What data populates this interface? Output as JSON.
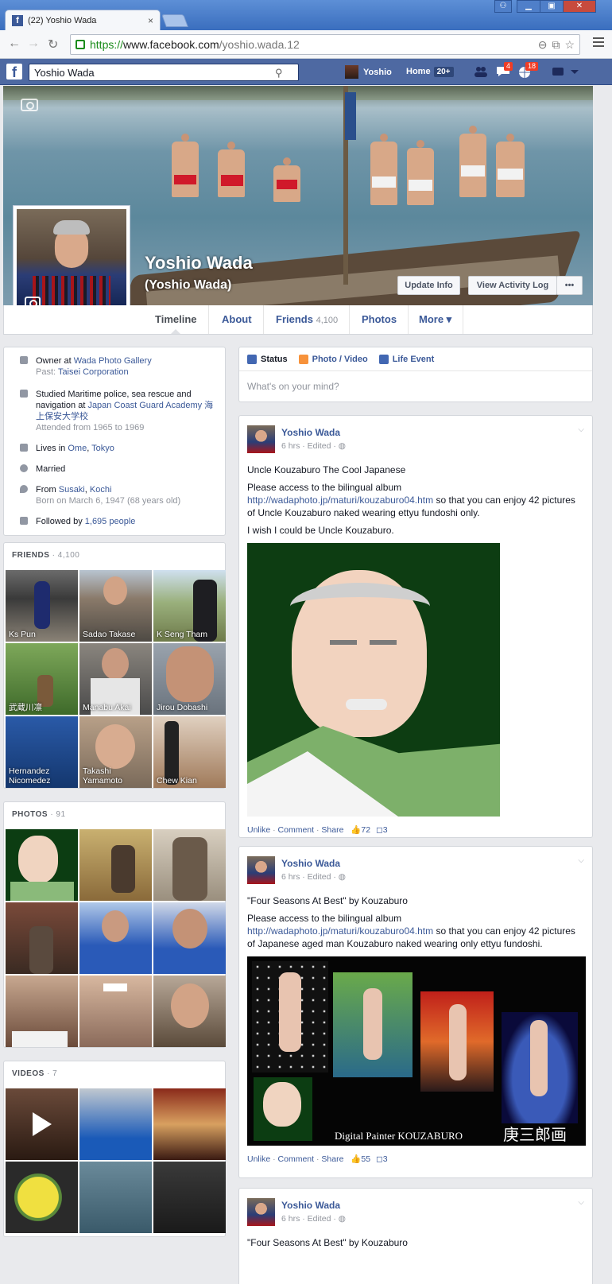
{
  "browser": {
    "tab_title": "(22) Yoshio Wada",
    "tab_close": "×",
    "url_https": "https://",
    "url_host": "www.facebook.com",
    "url_path": "/yoshio.wada.12"
  },
  "bluebar": {
    "search_value": "Yoshio  Wada",
    "user_label": "Yoshio",
    "home_label": "Home",
    "home_count": "20+",
    "messages_badge": "4",
    "notifications_badge": "18"
  },
  "profile": {
    "name": "Yoshio Wada",
    "alternate_name": "(Yoshio Wada)",
    "update_info": "Update Info",
    "view_activity_log": "View Activity Log",
    "more_dots": "•••"
  },
  "tabs": [
    {
      "label": "Timeline",
      "count": ""
    },
    {
      "label": "About",
      "count": ""
    },
    {
      "label": "Friends",
      "count": "4,100"
    },
    {
      "label": "Photos",
      "count": ""
    },
    {
      "label": "More ▾",
      "count": ""
    }
  ],
  "intro": {
    "work_prefix": "Owner at ",
    "work_link": "Wada Photo Gallery",
    "work_past_prefix": "Past: ",
    "work_past_link": "Taisei Corporation",
    "edu_prefix": "Studied Maritime police, sea rescue and navigation at ",
    "edu_link": "Japan Coast Guard Academy 海上保安大学校",
    "edu_sub": "Attended from 1965 to 1969",
    "lives_prefix": "Lives in ",
    "lives_link1": "Ome",
    "lives_sep": ", ",
    "lives_link2": "Tokyo",
    "relationship": "Married",
    "from_prefix": "From ",
    "from_link1": "Susaki",
    "from_sep": ", ",
    "from_link2": "Kochi",
    "born": "Born on March 6, 1947 (68 years old)",
    "followed_prefix": "Followed by ",
    "followed_link": "1,695 people"
  },
  "friends": {
    "title": "FRIENDS",
    "count": " · 4,100",
    "items": [
      "Ks Pun",
      "Sadao Takase",
      "K Seng Tham",
      "武蔵川凛",
      "Manabu Akai",
      "Jirou Dobashi",
      "Hernandez Nicomedez",
      "Takashi Yamamoto",
      "Chew Kian"
    ]
  },
  "photos": {
    "title": "PHOTOS",
    "count": " · 91"
  },
  "videos": {
    "title": "VIDEOS",
    "count": " · 7"
  },
  "composer": {
    "status": "Status",
    "photo_video": "Photo / Video",
    "life_event": "Life Event",
    "placeholder": "What's on your mind?"
  },
  "posts": [
    {
      "author": "Yoshio Wada",
      "meta": "6 hrs · Edited · ◍",
      "title": "Uncle Kouzaburo The Cool Japanese",
      "body_prefix": "Please access to the bilingual album ",
      "link": "http://wadaphoto.jp/maturi/kouzaburo04.htm",
      "body_suffix": " so that you can enjoy 42 pictures of Uncle Kouzaburo naked wearing ettyu fundoshi only.",
      "extra": "I wish I could be Uncle Kouzaburo.",
      "likes": "72",
      "comments": "3"
    },
    {
      "author": "Yoshio Wada",
      "meta": "6 hrs · Edited · ◍",
      "title": "\"Four Seasons At Best\" by Kouzaburo",
      "body_prefix": "Please access to the bilingual album ",
      "link": "http://wadaphoto.jp/maturi/kouzaburo04.htm",
      "body_suffix": " so that you can enjoy 42 pictures of Japanese aged man Kouzaburo naked wearing only ettyu fundoshi.",
      "image_caption": "Digital Painter  KOUZABURO",
      "image_signature": "庚三郎画",
      "likes": "55",
      "comments": "3"
    },
    {
      "author": "Yoshio Wada",
      "meta": "6 hrs · Edited · ◍",
      "title": "\"Four Seasons At Best\" by Kouzaburo"
    }
  ],
  "actions": {
    "unlike": "Unlike",
    "comment": "Comment",
    "share": "Share",
    "sep": " · "
  }
}
